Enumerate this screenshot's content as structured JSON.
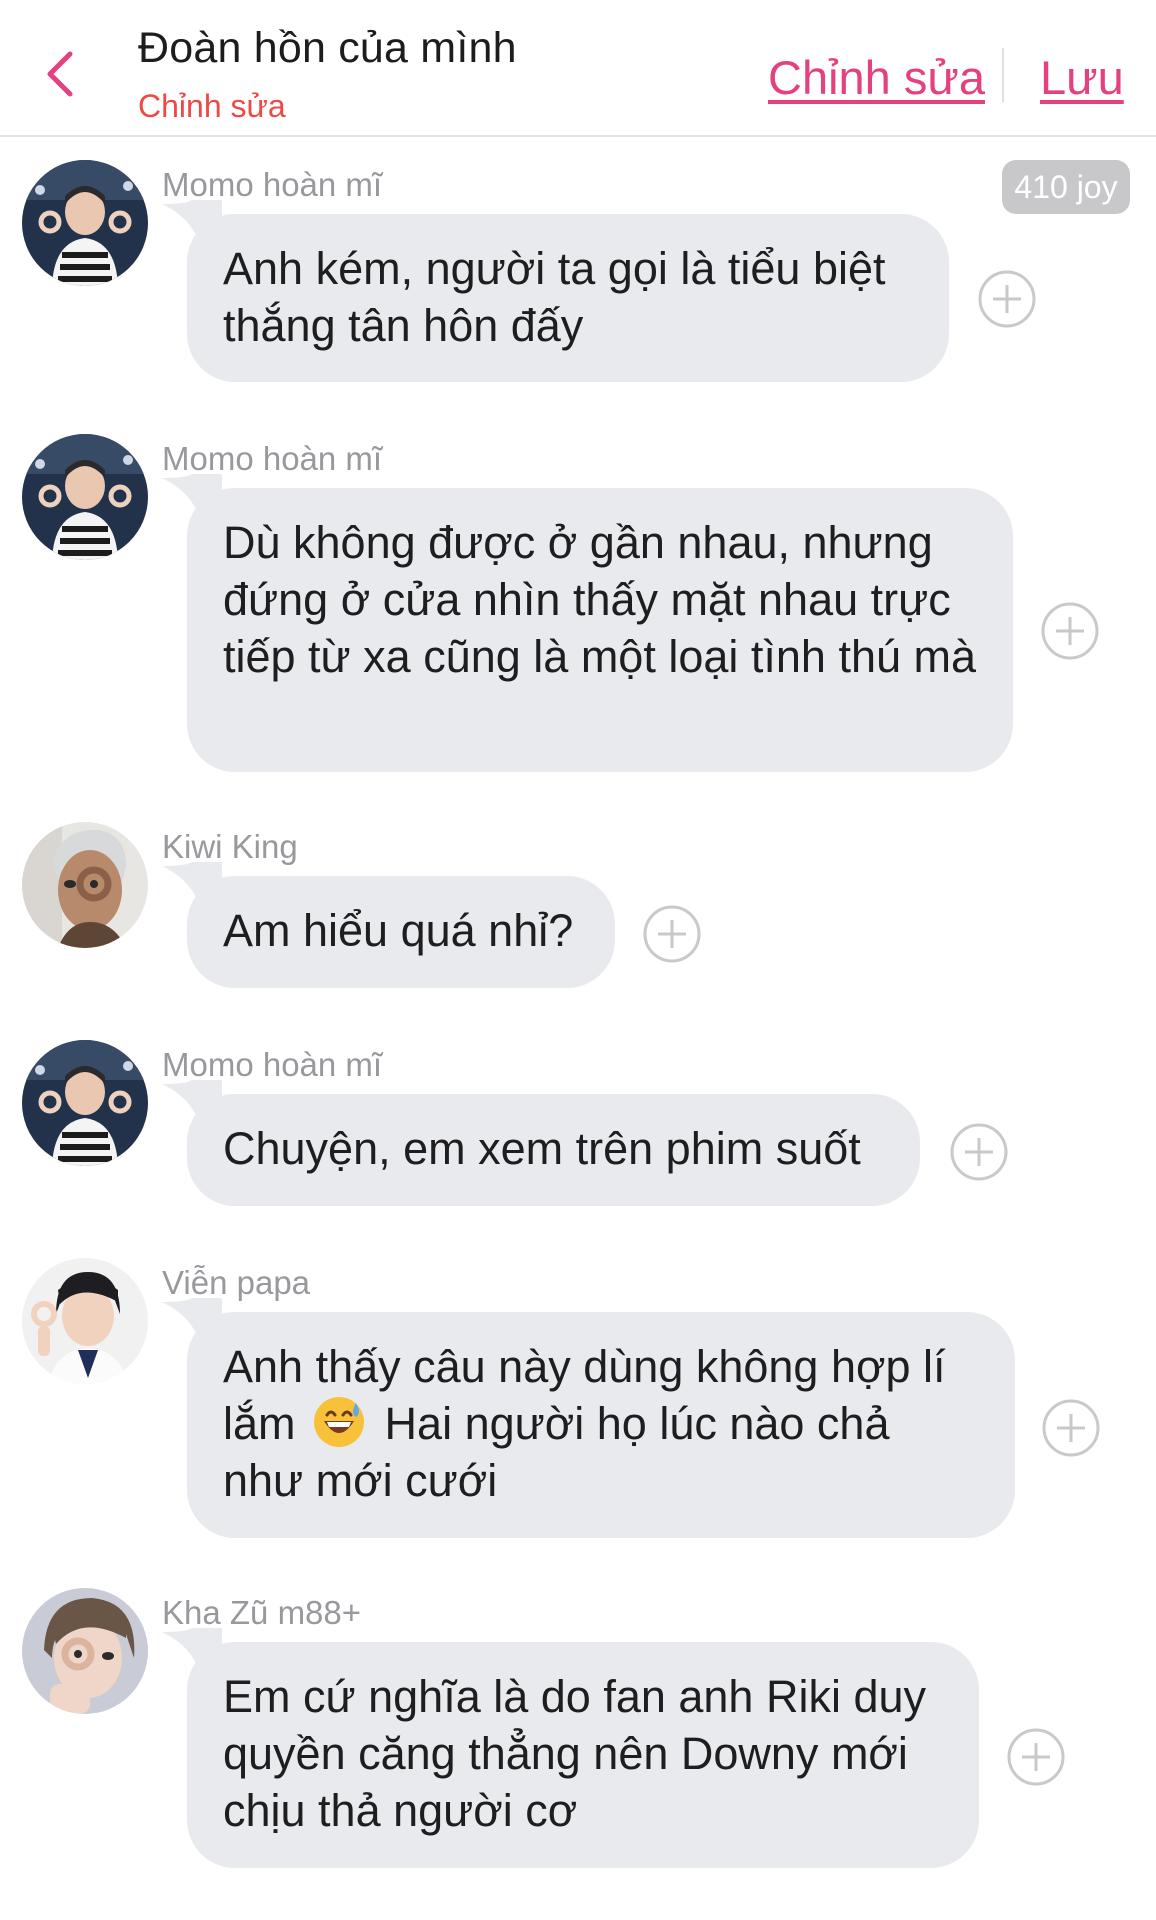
{
  "header": {
    "title": "Đoàn hồn của mình",
    "subtitle": "Chỉnh sửa",
    "edit_label": "Chỉnh sửa",
    "save_label": "Lưu",
    "back_icon": "chevron-left-icon",
    "accent": "#e5407f"
  },
  "joy_badge": "410 joy",
  "messages": [
    {
      "author": "Momo hoàn mĩ",
      "avatar": "avatar-momo",
      "text": "Anh kém, người ta gọi là tiểu biệt thắng tân hôn đấy"
    },
    {
      "author": "Momo hoàn mĩ",
      "avatar": "avatar-momo",
      "text": "Dù không được ở gần nhau, nhưng đứng ở cửa nhìn thấy mặt nhau trực tiếp từ xa cũng là một loại tình thú mà"
    },
    {
      "author": "Kiwi King",
      "avatar": "avatar-kiwi",
      "text": "Am hiểu quá nhỉ?"
    },
    {
      "author": "Momo hoàn mĩ",
      "avatar": "avatar-momo",
      "text": "Chuyện, em xem trên phim suốt"
    },
    {
      "author": "Viễn papa",
      "avatar": "avatar-vien",
      "text_before": "Anh thấy câu này dùng không hợp lí lắm",
      "emoji": "grinning-sweat-emoji",
      "text_after": "Hai người họ lúc nào chả như mới cưới"
    },
    {
      "author": "Kha Zũ m88+",
      "avatar": "avatar-kha",
      "text": "Em cứ nghĩa là do fan anh Riki duy quyền căng thẳng nên Downy mới chịu thả người cơ"
    }
  ]
}
